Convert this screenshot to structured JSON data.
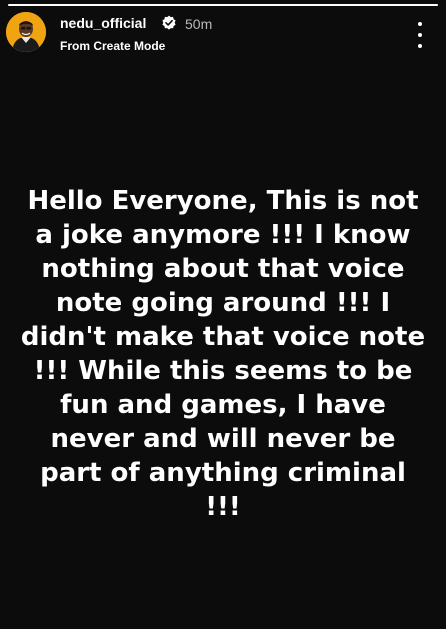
{
  "story": {
    "progress_fraction": 1.0,
    "username": "nedu_official",
    "verified": true,
    "timestamp": "50m",
    "subtitle": "From Create Mode",
    "text": "Hello Everyone, This is not a joke anymore !!! I know nothing about that voice note going around !!! I didn't make that voice note !!! While this seems to be fun and games, I have never and will never be part of anything criminal !!!",
    "background_color": "#0c0c0c",
    "text_color": "#ffffff"
  },
  "icons": {
    "avatar": "profile-photo",
    "verified": "verified-badge-icon",
    "menu": "more-vertical-icon"
  }
}
